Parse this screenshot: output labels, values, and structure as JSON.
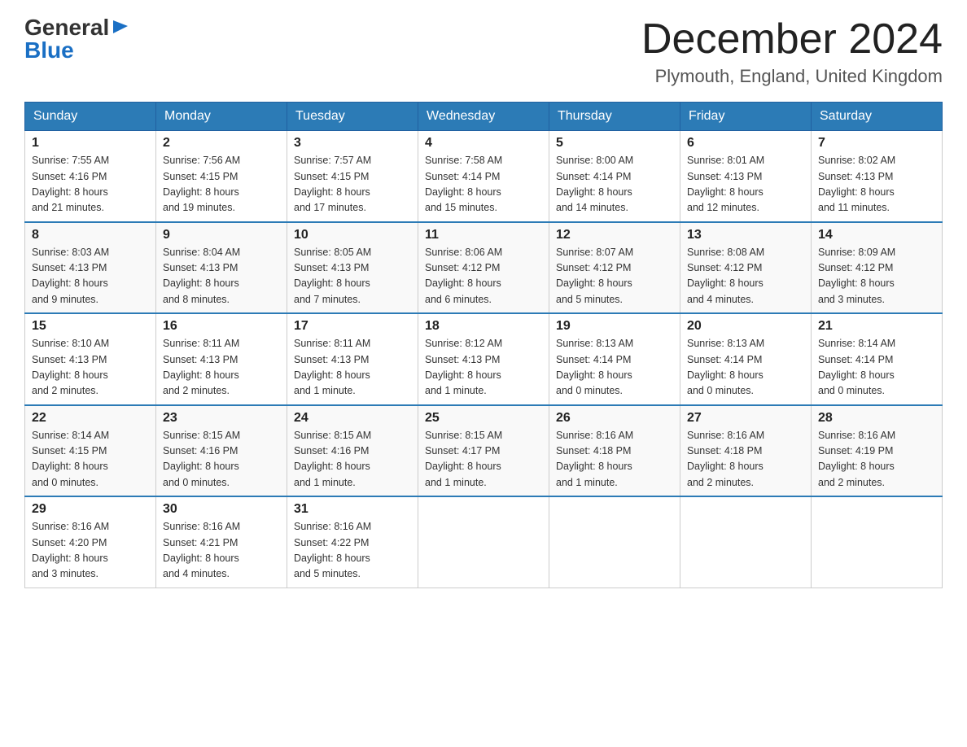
{
  "header": {
    "logo": {
      "general": "General",
      "arrow": "▶",
      "blue": "Blue"
    },
    "title": "December 2024",
    "location": "Plymouth, England, United Kingdom"
  },
  "days_of_week": [
    "Sunday",
    "Monday",
    "Tuesday",
    "Wednesday",
    "Thursday",
    "Friday",
    "Saturday"
  ],
  "weeks": [
    [
      {
        "day": "1",
        "sunrise": "7:55 AM",
        "sunset": "4:16 PM",
        "daylight": "8 hours and 21 minutes."
      },
      {
        "day": "2",
        "sunrise": "7:56 AM",
        "sunset": "4:15 PM",
        "daylight": "8 hours and 19 minutes."
      },
      {
        "day": "3",
        "sunrise": "7:57 AM",
        "sunset": "4:15 PM",
        "daylight": "8 hours and 17 minutes."
      },
      {
        "day": "4",
        "sunrise": "7:58 AM",
        "sunset": "4:14 PM",
        "daylight": "8 hours and 15 minutes."
      },
      {
        "day": "5",
        "sunrise": "8:00 AM",
        "sunset": "4:14 PM",
        "daylight": "8 hours and 14 minutes."
      },
      {
        "day": "6",
        "sunrise": "8:01 AM",
        "sunset": "4:13 PM",
        "daylight": "8 hours and 12 minutes."
      },
      {
        "day": "7",
        "sunrise": "8:02 AM",
        "sunset": "4:13 PM",
        "daylight": "8 hours and 11 minutes."
      }
    ],
    [
      {
        "day": "8",
        "sunrise": "8:03 AM",
        "sunset": "4:13 PM",
        "daylight": "8 hours and 9 minutes."
      },
      {
        "day": "9",
        "sunrise": "8:04 AM",
        "sunset": "4:13 PM",
        "daylight": "8 hours and 8 minutes."
      },
      {
        "day": "10",
        "sunrise": "8:05 AM",
        "sunset": "4:13 PM",
        "daylight": "8 hours and 7 minutes."
      },
      {
        "day": "11",
        "sunrise": "8:06 AM",
        "sunset": "4:12 PM",
        "daylight": "8 hours and 6 minutes."
      },
      {
        "day": "12",
        "sunrise": "8:07 AM",
        "sunset": "4:12 PM",
        "daylight": "8 hours and 5 minutes."
      },
      {
        "day": "13",
        "sunrise": "8:08 AM",
        "sunset": "4:12 PM",
        "daylight": "8 hours and 4 minutes."
      },
      {
        "day": "14",
        "sunrise": "8:09 AM",
        "sunset": "4:12 PM",
        "daylight": "8 hours and 3 minutes."
      }
    ],
    [
      {
        "day": "15",
        "sunrise": "8:10 AM",
        "sunset": "4:13 PM",
        "daylight": "8 hours and 2 minutes."
      },
      {
        "day": "16",
        "sunrise": "8:11 AM",
        "sunset": "4:13 PM",
        "daylight": "8 hours and 2 minutes."
      },
      {
        "day": "17",
        "sunrise": "8:11 AM",
        "sunset": "4:13 PM",
        "daylight": "8 hours and 1 minute."
      },
      {
        "day": "18",
        "sunrise": "8:12 AM",
        "sunset": "4:13 PM",
        "daylight": "8 hours and 1 minute."
      },
      {
        "day": "19",
        "sunrise": "8:13 AM",
        "sunset": "4:14 PM",
        "daylight": "8 hours and 0 minutes."
      },
      {
        "day": "20",
        "sunrise": "8:13 AM",
        "sunset": "4:14 PM",
        "daylight": "8 hours and 0 minutes."
      },
      {
        "day": "21",
        "sunrise": "8:14 AM",
        "sunset": "4:14 PM",
        "daylight": "8 hours and 0 minutes."
      }
    ],
    [
      {
        "day": "22",
        "sunrise": "8:14 AM",
        "sunset": "4:15 PM",
        "daylight": "8 hours and 0 minutes."
      },
      {
        "day": "23",
        "sunrise": "8:15 AM",
        "sunset": "4:16 PM",
        "daylight": "8 hours and 0 minutes."
      },
      {
        "day": "24",
        "sunrise": "8:15 AM",
        "sunset": "4:16 PM",
        "daylight": "8 hours and 1 minute."
      },
      {
        "day": "25",
        "sunrise": "8:15 AM",
        "sunset": "4:17 PM",
        "daylight": "8 hours and 1 minute."
      },
      {
        "day": "26",
        "sunrise": "8:16 AM",
        "sunset": "4:18 PM",
        "daylight": "8 hours and 1 minute."
      },
      {
        "day": "27",
        "sunrise": "8:16 AM",
        "sunset": "4:18 PM",
        "daylight": "8 hours and 2 minutes."
      },
      {
        "day": "28",
        "sunrise": "8:16 AM",
        "sunset": "4:19 PM",
        "daylight": "8 hours and 2 minutes."
      }
    ],
    [
      {
        "day": "29",
        "sunrise": "8:16 AM",
        "sunset": "4:20 PM",
        "daylight": "8 hours and 3 minutes."
      },
      {
        "day": "30",
        "sunrise": "8:16 AM",
        "sunset": "4:21 PM",
        "daylight": "8 hours and 4 minutes."
      },
      {
        "day": "31",
        "sunrise": "8:16 AM",
        "sunset": "4:22 PM",
        "daylight": "8 hours and 5 minutes."
      },
      null,
      null,
      null,
      null
    ]
  ],
  "labels": {
    "sunrise": "Sunrise:",
    "sunset": "Sunset:",
    "daylight": "Daylight:"
  }
}
